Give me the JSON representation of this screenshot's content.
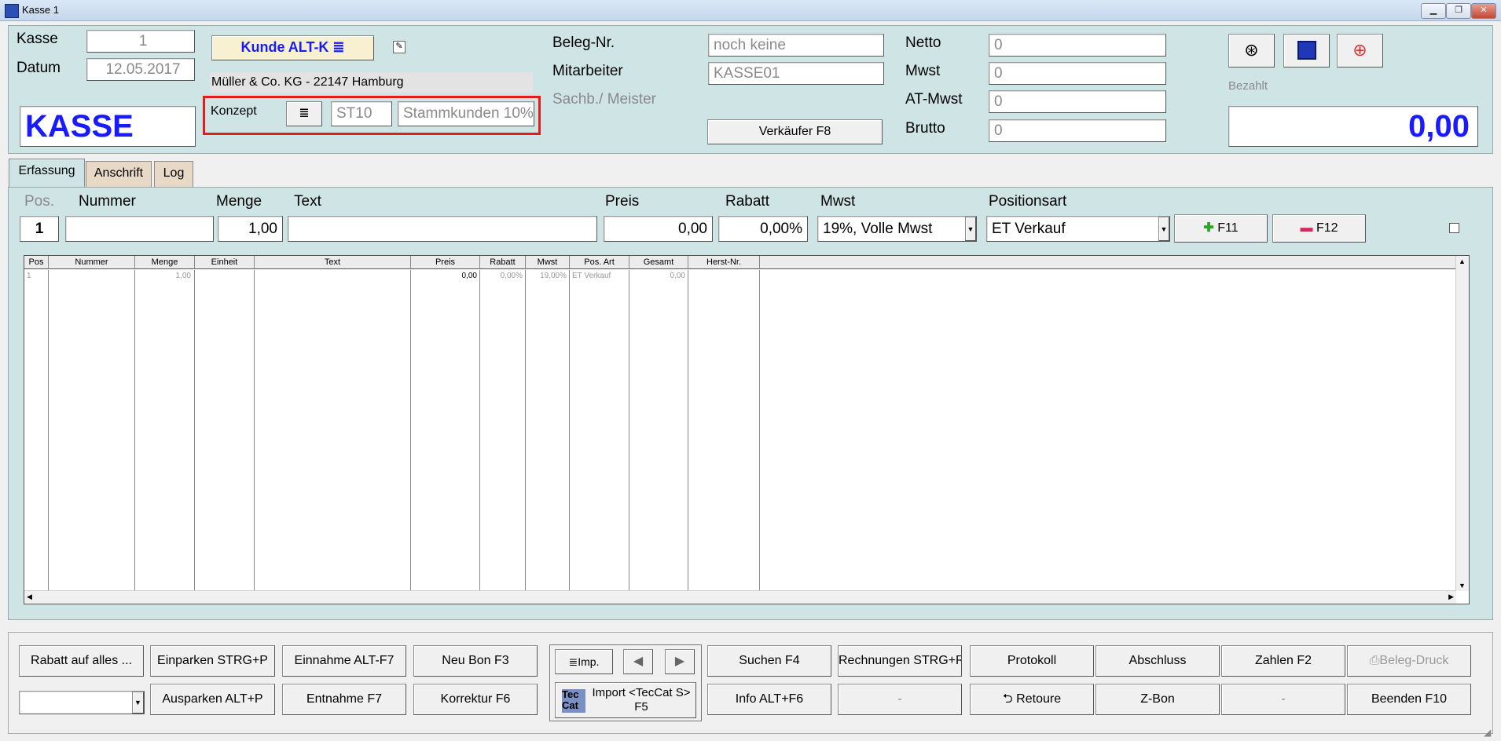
{
  "window": {
    "title": "Kasse 1",
    "minimize": "▁",
    "maximize": "❐",
    "close": "✕"
  },
  "header": {
    "kasse_label": "Kasse",
    "kasse_value": "1",
    "datum_label": "Datum",
    "datum_value": "12.05.2017",
    "big_title": "KASSE",
    "kunde_button": "Kunde ALT-K ≣",
    "customer_line": "Müller & Co. KG - 22147 Hamburg",
    "konzept_label": "Konzept",
    "konzept_list_btn": "≣",
    "konzept_code": "ST10",
    "konzept_name": "Stammkunden 10%",
    "beleg_label": "Beleg-Nr.",
    "beleg_value": "noch keine",
    "mitarbeiter_label": "Mitarbeiter",
    "mitarbeiter_value": "KASSE01",
    "sachb_label": "Sachb./ Meister",
    "verkaeufer_button": "Verkäufer F8",
    "netto_label": "Netto",
    "netto_value": "0",
    "mwst_label": "Mwst",
    "mwst_value": "0",
    "atmwst_label": "AT-Mwst",
    "atmwst_value": "0",
    "brutto_label": "Brutto",
    "brutto_value": "0",
    "bezahlt_label": "Bezahlt",
    "bezahlt_value": "0,00"
  },
  "tabs": [
    {
      "label": "Erfassung"
    },
    {
      "label": "Anschrift"
    },
    {
      "label": "Log"
    }
  ],
  "entry": {
    "pos_label": "Pos.",
    "nummer_label": "Nummer",
    "menge_label": "Menge",
    "text_label": "Text",
    "preis_label": "Preis",
    "rabatt_label": "Rabatt",
    "mwst_label": "Mwst",
    "positionsart_label": "Positionsart",
    "pos_value": "1",
    "nummer_value": "",
    "menge_value": "1,00",
    "text_value": "",
    "preis_value": "0,00",
    "rabatt_value": "0,00%",
    "mwst_value": "19%, Volle Mwst",
    "positionsart_value": "ET Verkauf",
    "add_button": "F11",
    "remove_button": "F12"
  },
  "grid": {
    "columns": [
      "Pos",
      "Nummer",
      "Menge",
      "Einheit",
      "Text",
      "Preis",
      "Rabatt",
      "Mwst",
      "Pos. Art",
      "Gesamt",
      "Herst-Nr."
    ],
    "rows": [
      {
        "pos": "1",
        "nummer": "",
        "menge": "1,00",
        "einheit": "",
        "text": "",
        "preis": "0,00",
        "rabatt": "0,00%",
        "mwst": "19,00%",
        "posart": "ET Verkauf",
        "gesamt": "0,00",
        "herst": ""
      }
    ]
  },
  "bottom": {
    "rabatt_alles": "Rabatt auf alles ...",
    "einparken": "Einparken STRG+P",
    "ausparken": "Ausparken ALT+P",
    "einnahme": "Einnahme ALT-F7",
    "entnahme": "Entnahme F7",
    "neu_bon": "Neu Bon F3",
    "korrektur": "Korrektur F6",
    "imp": "≣Imp.",
    "import_line1": "Import <TecCat S>",
    "import_line2": "F5",
    "tec": "Tec",
    "cat": "Cat",
    "suchen": "Suchen F4",
    "info": "Info ALT+F6",
    "rechnungen": "Rechnungen STRG+R",
    "dash1": "-",
    "protokoll": "Protokoll",
    "retoure": "⮌ Retoure",
    "abschluss": "Abschluss",
    "zbon": "Z-Bon",
    "zahlen": "Zahlen F2",
    "dash2": "-",
    "beleg_druck": "Beleg-Druck",
    "beenden": "Beenden F10"
  },
  "colors": {
    "panel": "#cfe4e4",
    "accent_blue": "#1a1aff",
    "highlight_red": "#e41b1b"
  }
}
